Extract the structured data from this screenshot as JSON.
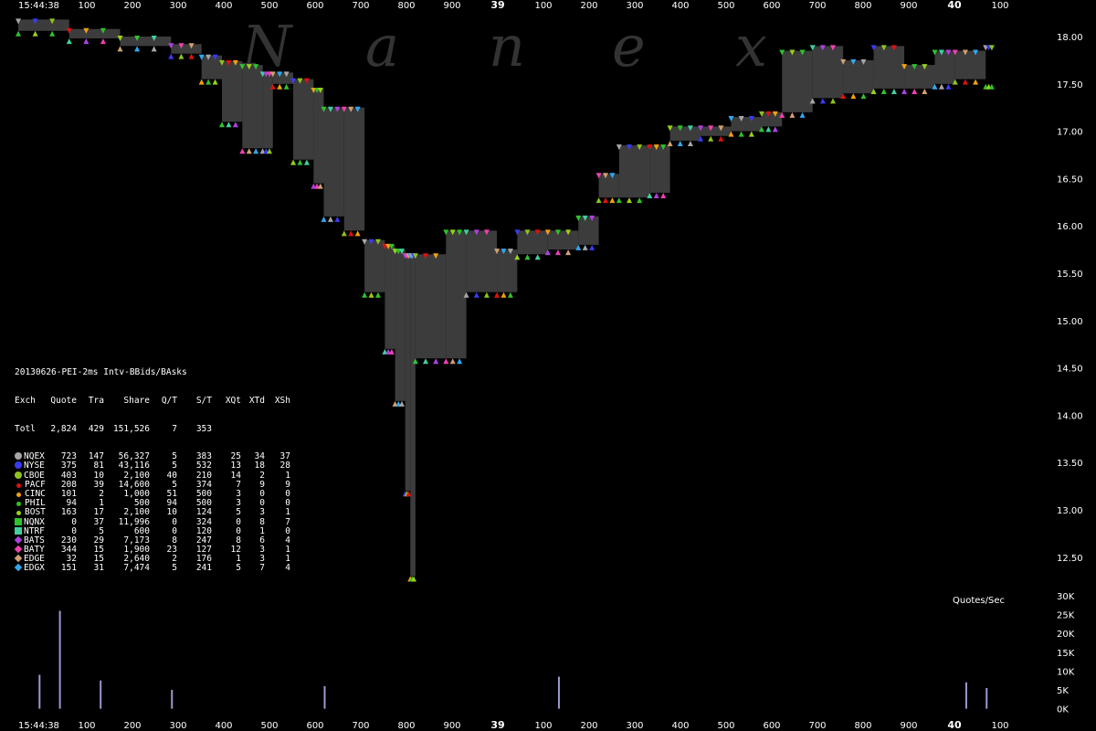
{
  "chart_data": {
    "type": "scatter",
    "title": "20130626-PEI-2ms Intv-BBids/BAsks",
    "watermark": [
      "N",
      "a",
      "n",
      "e",
      "x"
    ],
    "x_axis": {
      "start_label": "15:44:38",
      "ticks_top": [
        "100",
        "200",
        "300",
        "400",
        "500",
        "600",
        "700",
        "800",
        "900",
        "39",
        "100",
        "200",
        "300",
        "400",
        "500",
        "600",
        "700",
        "800",
        "900",
        "40",
        "100"
      ],
      "bold_ticks": [
        "39",
        "40"
      ]
    },
    "y_axis": {
      "ticks": [
        "18.00",
        "17.50",
        "17.00",
        "16.50",
        "16.00",
        "15.50",
        "15.00",
        "14.50",
        "14.00",
        "13.50",
        "13.00",
        "12.50"
      ],
      "ylim": [
        12.1,
        18.2
      ]
    },
    "volume_axis": {
      "label": "Quotes/Sec",
      "ticks": [
        "30K",
        "25K",
        "20K",
        "15K",
        "10K",
        "5K",
        "0K"
      ]
    },
    "best_bid_ask_path": [
      {
        "t": 0.0,
        "bid": 18.06,
        "ask": 18.18
      },
      {
        "t": 0.05,
        "bid": 17.98,
        "ask": 18.08
      },
      {
        "t": 0.1,
        "bid": 17.9,
        "ask": 18.0
      },
      {
        "t": 0.15,
        "bid": 17.82,
        "ask": 17.92
      },
      {
        "t": 0.18,
        "bid": 17.55,
        "ask": 17.8
      },
      {
        "t": 0.2,
        "bid": 17.1,
        "ask": 17.74
      },
      {
        "t": 0.22,
        "bid": 16.82,
        "ask": 17.7
      },
      {
        "t": 0.24,
        "bid": 16.82,
        "ask": 17.62
      },
      {
        "t": 0.25,
        "bid": 17.5,
        "ask": 17.62
      },
      {
        "t": 0.27,
        "bid": 16.7,
        "ask": 17.55
      },
      {
        "t": 0.29,
        "bid": 16.45,
        "ask": 17.45
      },
      {
        "t": 0.3,
        "bid": 16.1,
        "ask": 17.25
      },
      {
        "t": 0.32,
        "bid": 15.95,
        "ask": 17.25
      },
      {
        "t": 0.34,
        "bid": 15.3,
        "ask": 15.85
      },
      {
        "t": 0.36,
        "bid": 14.7,
        "ask": 15.8
      },
      {
        "t": 0.37,
        "bid": 14.15,
        "ask": 15.75
      },
      {
        "t": 0.38,
        "bid": 13.2,
        "ask": 15.7
      },
      {
        "t": 0.385,
        "bid": 12.3,
        "ask": 15.7
      },
      {
        "t": 0.39,
        "bid": 14.6,
        "ask": 15.7
      },
      {
        "t": 0.42,
        "bid": 14.6,
        "ask": 15.95
      },
      {
        "t": 0.44,
        "bid": 15.3,
        "ask": 15.95
      },
      {
        "t": 0.47,
        "bid": 15.3,
        "ask": 15.75
      },
      {
        "t": 0.49,
        "bid": 15.7,
        "ask": 15.95
      },
      {
        "t": 0.52,
        "bid": 15.75,
        "ask": 15.95
      },
      {
        "t": 0.55,
        "bid": 15.8,
        "ask": 16.1
      },
      {
        "t": 0.57,
        "bid": 16.3,
        "ask": 16.55
      },
      {
        "t": 0.59,
        "bid": 16.3,
        "ask": 16.85
      },
      {
        "t": 0.62,
        "bid": 16.35,
        "ask": 16.85
      },
      {
        "t": 0.64,
        "bid": 16.9,
        "ask": 17.05
      },
      {
        "t": 0.67,
        "bid": 16.95,
        "ask": 17.05
      },
      {
        "t": 0.7,
        "bid": 17.0,
        "ask": 17.15
      },
      {
        "t": 0.73,
        "bid": 17.05,
        "ask": 17.2
      },
      {
        "t": 0.75,
        "bid": 17.2,
        "ask": 17.85
      },
      {
        "t": 0.78,
        "bid": 17.35,
        "ask": 17.9
      },
      {
        "t": 0.81,
        "bid": 17.4,
        "ask": 17.75
      },
      {
        "t": 0.84,
        "bid": 17.45,
        "ask": 17.9
      },
      {
        "t": 0.87,
        "bid": 17.45,
        "ask": 17.7
      },
      {
        "t": 0.9,
        "bid": 17.5,
        "ask": 17.85
      },
      {
        "t": 0.92,
        "bid": 17.55,
        "ask": 17.85
      },
      {
        "t": 0.95,
        "bid": 17.5,
        "ask": 17.9
      }
    ],
    "volume_spikes": [
      {
        "t": 0.04,
        "v": 26000
      },
      {
        "t": 0.02,
        "v": 9000
      },
      {
        "t": 0.08,
        "v": 7500
      },
      {
        "t": 0.15,
        "v": 5000
      },
      {
        "t": 0.3,
        "v": 6000
      },
      {
        "t": 0.53,
        "v": 8500
      },
      {
        "t": 0.93,
        "v": 7000
      },
      {
        "t": 0.95,
        "v": 5500
      }
    ],
    "legend_stats": {
      "header": [
        "Exch",
        "Quote",
        "Tra",
        "Share",
        "Q/T",
        "S/T",
        "XQt",
        "XTd",
        "XSh"
      ],
      "total": {
        "label": "Totl",
        "values": [
          "2,824",
          "429",
          "151,526",
          "7",
          "353",
          "",
          "",
          ""
        ]
      },
      "rows": [
        {
          "exch": "NQEX",
          "color": "#a6a6a6",
          "shape": "circle",
          "values": [
            "723",
            "147",
            "56,327",
            "5",
            "383",
            "25",
            "34",
            "37"
          ]
        },
        {
          "exch": "NYSE",
          "color": "#3a3af5",
          "shape": "circle",
          "values": [
            "375",
            "81",
            "43,116",
            "5",
            "532",
            "13",
            "18",
            "28"
          ]
        },
        {
          "exch": "CBOE",
          "color": "#8ec21e",
          "shape": "circle",
          "values": [
            "403",
            "10",
            "2,100",
            "40",
            "210",
            "14",
            "2",
            "1"
          ]
        },
        {
          "exch": "PACF",
          "color": "#e01010",
          "shape": "dot",
          "values": [
            "208",
            "39",
            "14,600",
            "5",
            "374",
            "7",
            "9",
            "9"
          ]
        },
        {
          "exch": "CINC",
          "color": "#f0a010",
          "shape": "dot",
          "values": [
            "101",
            "2",
            "1,000",
            "51",
            "500",
            "3",
            "0",
            "0"
          ]
        },
        {
          "exch": "PHIL",
          "color": "#30c030",
          "shape": "dot",
          "values": [
            "94",
            "1",
            "500",
            "94",
            "500",
            "3",
            "0",
            "0"
          ]
        },
        {
          "exch": "BOST",
          "color": "#9ad01a",
          "shape": "dot",
          "values": [
            "163",
            "17",
            "2,100",
            "10",
            "124",
            "5",
            "3",
            "1"
          ]
        },
        {
          "exch": "NQNX",
          "color": "#2ec42e",
          "shape": "square",
          "values": [
            "0",
            "37",
            "11,996",
            "0",
            "324",
            "0",
            "8",
            "7"
          ]
        },
        {
          "exch": "NTRF",
          "color": "#40d0a0",
          "shape": "square",
          "values": [
            "0",
            "5",
            "600",
            "0",
            "120",
            "0",
            "1",
            "0"
          ]
        },
        {
          "exch": "BATS",
          "color": "#b040e0",
          "shape": "diamond",
          "values": [
            "230",
            "29",
            "7,173",
            "8",
            "247",
            "8",
            "6",
            "4"
          ]
        },
        {
          "exch": "BATY",
          "color": "#f040b0",
          "shape": "diamond",
          "values": [
            "344",
            "15",
            "1,900",
            "23",
            "127",
            "12",
            "3",
            "1"
          ]
        },
        {
          "exch": "EDGE",
          "color": "#d0a070",
          "shape": "diamond",
          "values": [
            "32",
            "15",
            "2,640",
            "2",
            "176",
            "1",
            "3",
            "1"
          ]
        },
        {
          "exch": "EDGX",
          "color": "#30a8f0",
          "shape": "diamond",
          "values": [
            "151",
            "31",
            "7,474",
            "5",
            "241",
            "5",
            "7",
            "4"
          ]
        }
      ]
    }
  }
}
